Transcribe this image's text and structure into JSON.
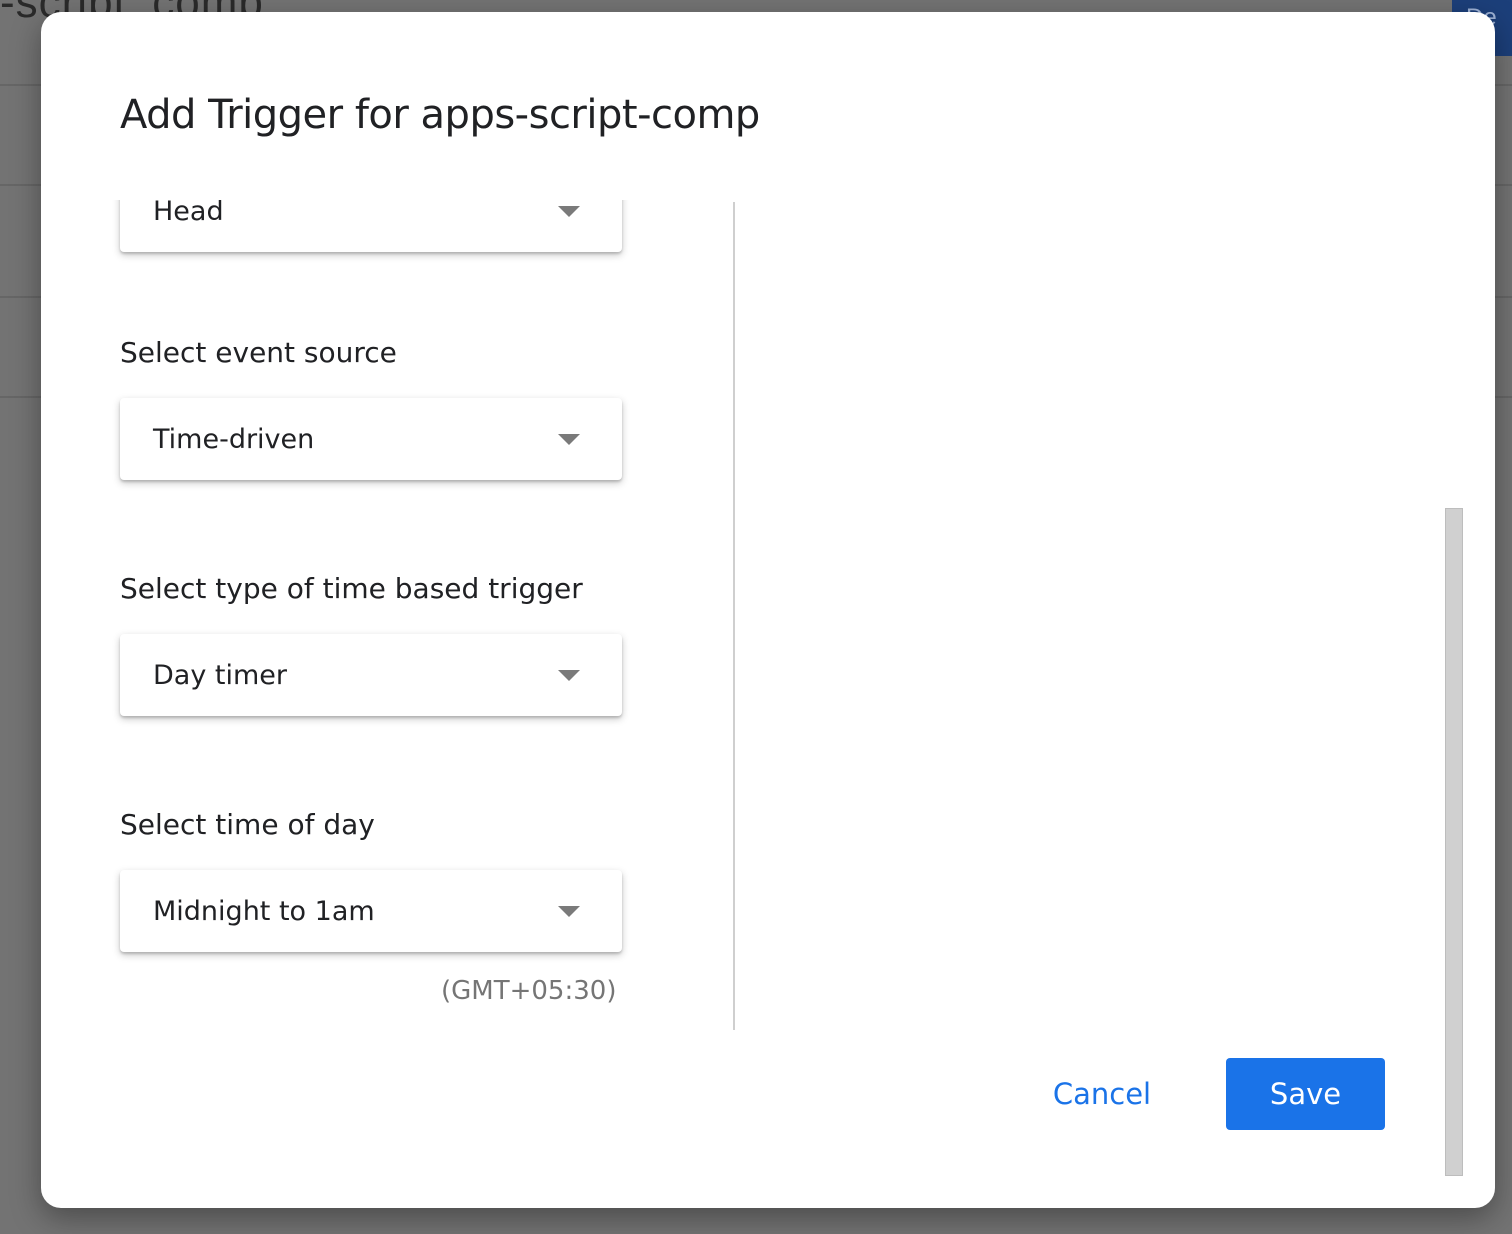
{
  "background": {
    "page_title_fragment": "-script_comp",
    "top_right_button_fragment": "De"
  },
  "dialog": {
    "title": "Add Trigger for apps-script-comp",
    "fields": [
      {
        "label": "",
        "value": "Head"
      },
      {
        "label": "Select event source",
        "value": "Time-driven"
      },
      {
        "label": "Select type of time based trigger",
        "value": "Day timer"
      },
      {
        "label": "Select time of day",
        "value": "Midnight to 1am"
      }
    ],
    "timezone_note": "(GMT+05:30)",
    "actions": {
      "cancel_label": "Cancel",
      "save_label": "Save"
    }
  },
  "colors": {
    "accent": "#1a73e8",
    "text": "#202124",
    "muted": "#757575"
  },
  "icons": {
    "dropdown": "chevron-down-icon"
  }
}
